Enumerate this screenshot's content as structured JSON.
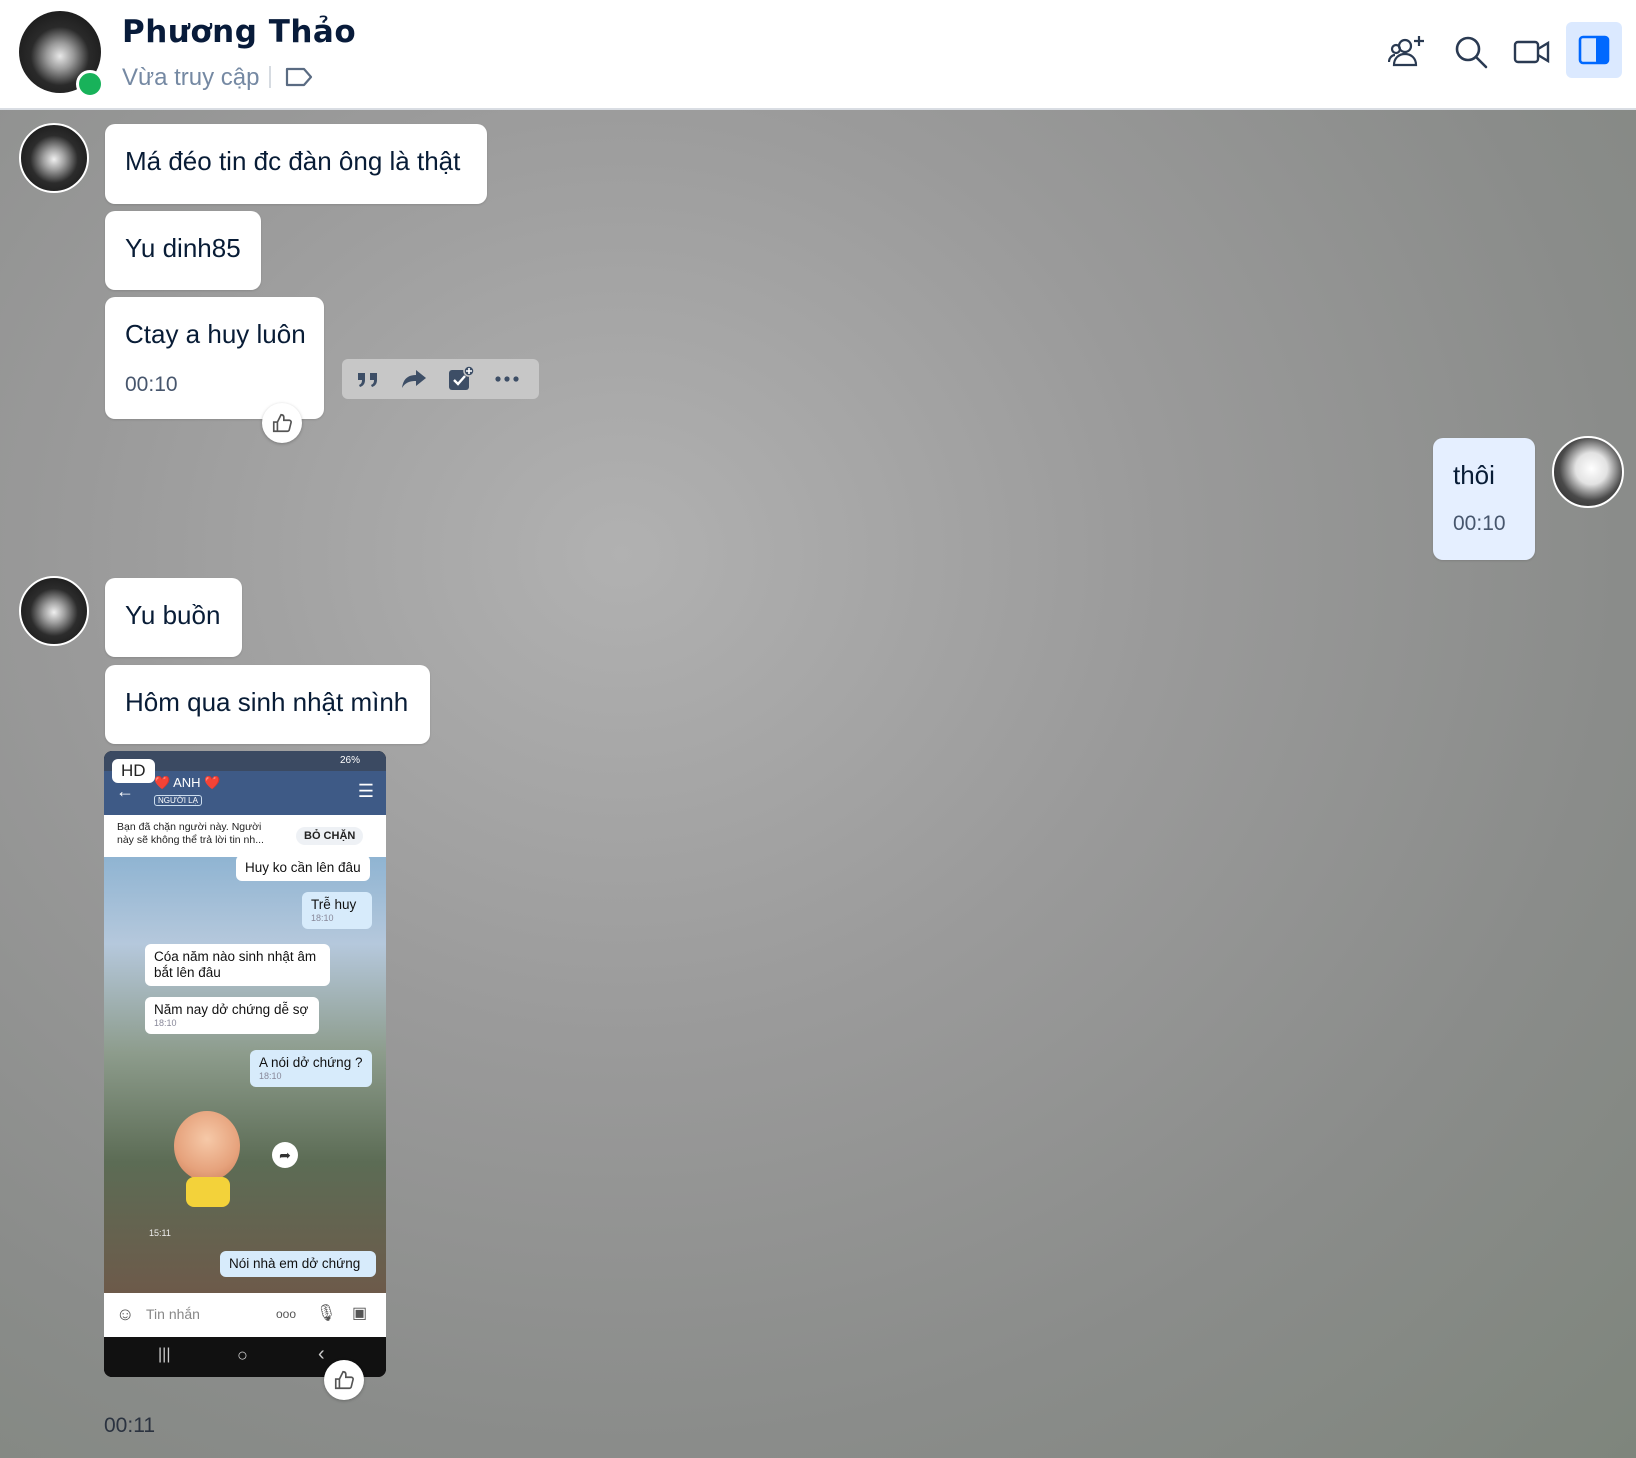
{
  "header": {
    "name": "Phương Thảo",
    "status": "Vừa truy cập",
    "icons": [
      "add-group-icon",
      "search-icon",
      "video-call-icon",
      "sidebar-toggle-icon"
    ]
  },
  "messages": {
    "m1": "Má đéo tin đc đàn ông là thật",
    "m2": "Yu dinh85",
    "m3": "Ctay a huy luôn",
    "m3_time": "00:10",
    "m4": "thôi",
    "m4_time": "00:10",
    "m5": "Yu buồn",
    "m6": "Hôm qua sinh nhật mình",
    "image_time": "00:11"
  },
  "image": {
    "badge": "HD",
    "status_battery": "26%",
    "contact": "❤️ ANH ❤️",
    "contact_tag": "NGƯỜI LẠ",
    "blocked_text": "Bạn đã chặn người này. Người này sẽ không thể trả lời tin nh...",
    "unblock": "BỎ CHẶN",
    "msg_a": "Huy ko cần lên đâu",
    "msg_b": "Trễ huy",
    "msg_b_time": "18:10",
    "msg_c": "Cóa năm nào sinh nhật âm bắt lên đâu",
    "msg_d": "Năm nay dở chứng dễ sợ",
    "msg_d_time": "18:10",
    "msg_e": "A nói dở chứng ?",
    "msg_e_time": "18:10",
    "sticker_time": "15:11",
    "msg_f": "Nói nhà em dở chứng",
    "input_placeholder": "Tin nhắn"
  },
  "colors": {
    "header_bg": "#ffffff",
    "name": "#081b3a",
    "online": "#18b25a",
    "my_bubble": "#e5efff",
    "active_icon_bg": "#dbe9ff",
    "accent": "#0068ff"
  }
}
